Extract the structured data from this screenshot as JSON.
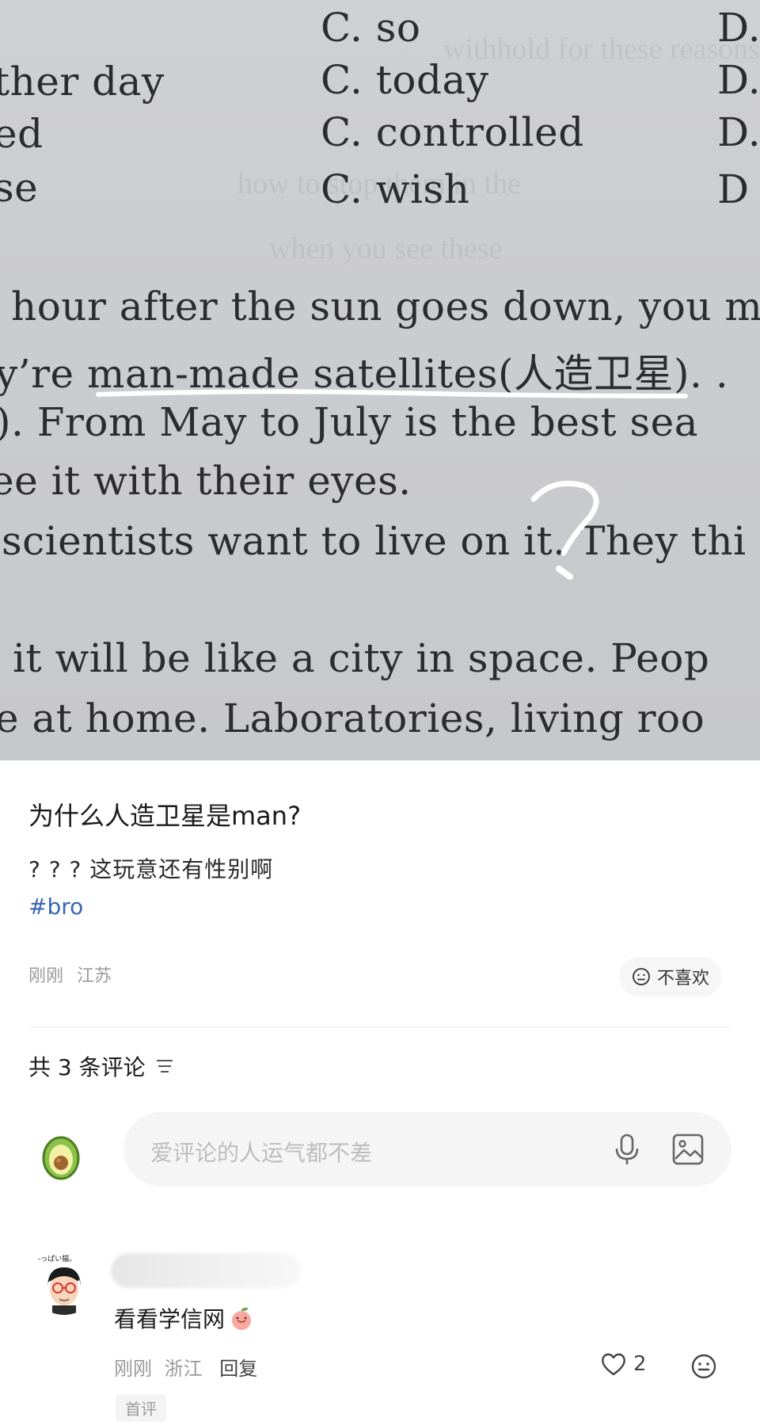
{
  "photo": {
    "option_lines": [
      "C. so",
      "C. today",
      "C. controlled",
      "C. wish"
    ],
    "left_fragments": [
      "ther day",
      "ed",
      "se"
    ],
    "right_fragments": [
      "D.",
      "D.",
      "D.",
      "D"
    ],
    "paragraph_lines": [
      "hour after the sun goes down, you m",
      "y’re man-made satellites(人造卫星). .",
      "). From May to July is the best sea",
      "ee it with their eyes.",
      "scientists want to live on it. They thi",
      "it will be like a city in space. Peop",
      "e at home. Laboratories, living roo"
    ]
  },
  "post": {
    "title": "为什么人造卫星是man?",
    "body": "? ? ? 这玩意还有性别啊",
    "tag": "#bro",
    "time": "刚刚",
    "location": "江苏",
    "dislike_label": "不喜欢"
  },
  "comments_section": {
    "header": "共 3 条评论",
    "input_placeholder": "爱评论的人运气都不差"
  },
  "comment": {
    "avatar_caption": "-っぱい猫。",
    "text": "看看学信网",
    "time": "刚刚",
    "location": "浙江",
    "reply_label": "回复",
    "like_count": "2",
    "badge": "首评"
  }
}
